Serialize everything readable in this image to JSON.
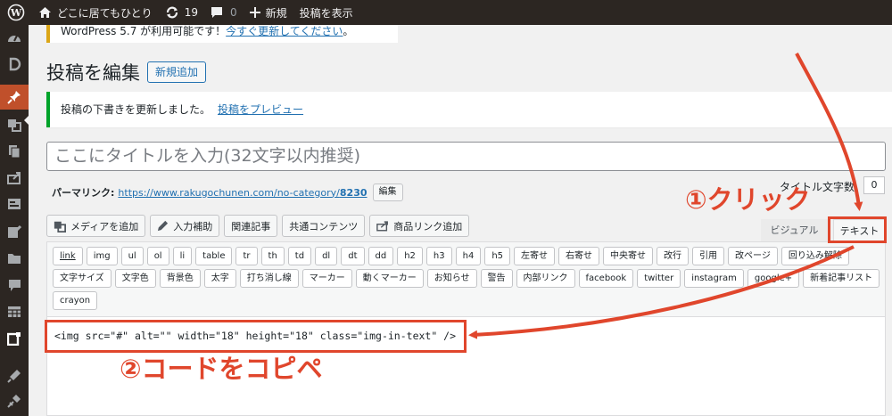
{
  "adminbar": {
    "site_name": "どこに居てもひとり",
    "updates_count": "19",
    "comments_count": "0",
    "new_label": "新規",
    "view_post_label": "投稿を表示"
  },
  "update_notice": {
    "text": "WordPress 5.7 が利用可能です！",
    "link": "今すぐ更新してください",
    "tail": "。"
  },
  "page": {
    "title": "投稿を編集",
    "add_new_label": "新規追加"
  },
  "success_notice": {
    "text": "投稿の下書きを更新しました。",
    "link": "投稿をプレビュー"
  },
  "title_field": {
    "placeholder": "ここにタイトルを入力(32文字以内推奨)"
  },
  "title_count": {
    "label": "タイトル文字数",
    "value": "0"
  },
  "permalink": {
    "label": "パーマリンク:",
    "url": "https://www.rakugochunen.com/no-category/",
    "slug": "8230",
    "edit_label": "編集"
  },
  "media_buttons": [
    {
      "label": "メディアを追加"
    },
    {
      "label": "入力補助"
    },
    {
      "label": "関連記事"
    },
    {
      "label": "共通コンテンツ"
    },
    {
      "label": "商品リンク追加"
    }
  ],
  "editor_tabs": {
    "visual": "ビジュアル",
    "text": "テキスト"
  },
  "quicktags": [
    "link",
    "img",
    "ul",
    "ol",
    "li",
    "table",
    "tr",
    "th",
    "td",
    "dl",
    "dt",
    "dd",
    "h2",
    "h3",
    "h4",
    "h5",
    "左寄せ",
    "右寄せ",
    "中央寄せ",
    "改行",
    "引用",
    "改ページ",
    "回り込み解除",
    "文字サイズ",
    "文字色",
    "背景色",
    "太字",
    "打ち消し線",
    "マーカー",
    "動くマーカー",
    "お知らせ",
    "警告",
    "内部リンク",
    "facebook",
    "twitter",
    "instagram",
    "google+",
    "新着記事リスト",
    "crayon"
  ],
  "editor_content": "<img src=\"#\" alt=\"\" width=\"18\" height=\"18\" class=\"img-in-text\" />",
  "annotations": {
    "step1": "①クリック",
    "step2": "②コードをコピペ",
    "color": "#e0462c"
  },
  "colors": {
    "adminbar": "#2c2622",
    "active_menu": "#c0502b",
    "link": "#2271b1",
    "success": "#00a32a"
  }
}
